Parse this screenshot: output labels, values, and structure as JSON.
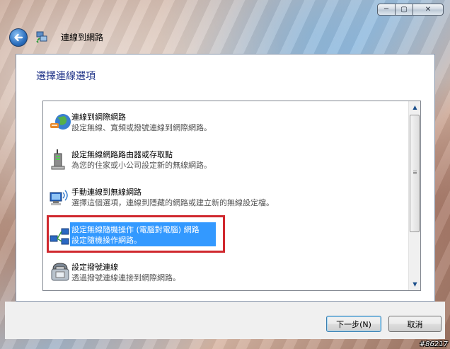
{
  "window": {
    "title": "連線到網路",
    "caption": {
      "minimize": "─",
      "maximize": "▢",
      "close": "✕"
    }
  },
  "content": {
    "heading": "選擇連線選項",
    "options": [
      {
        "title": "連線到網際網路",
        "description": "設定無線、寬頻或撥號連線到網際網路。",
        "icon": "internet-globe-icon"
      },
      {
        "title": "設定無線網路路由器或存取點",
        "description": "為您的住家或小公司設定新的無線網路。",
        "icon": "router-icon"
      },
      {
        "title": "手動連線到無線網路",
        "description": "選擇這個選項，連線到隱藏的網路或建立新的無線設定檔。",
        "icon": "wireless-computers-icon"
      },
      {
        "title": "設定無線隨機操作 (電腦對電腦) 網路",
        "description": "設定隨機操作網路。",
        "icon": "adhoc-network-icon",
        "selected": true
      },
      {
        "title": "設定撥號連線",
        "description": "透過撥號連線連接到網際網路。",
        "icon": "dialup-phone-icon"
      }
    ]
  },
  "buttons": {
    "next": "下一步(N)",
    "cancel": "取消"
  },
  "watermark": "#86217",
  "colors": {
    "selection": "#3399ff",
    "highlight_box": "#d0282e",
    "heading": "#1e3287"
  }
}
